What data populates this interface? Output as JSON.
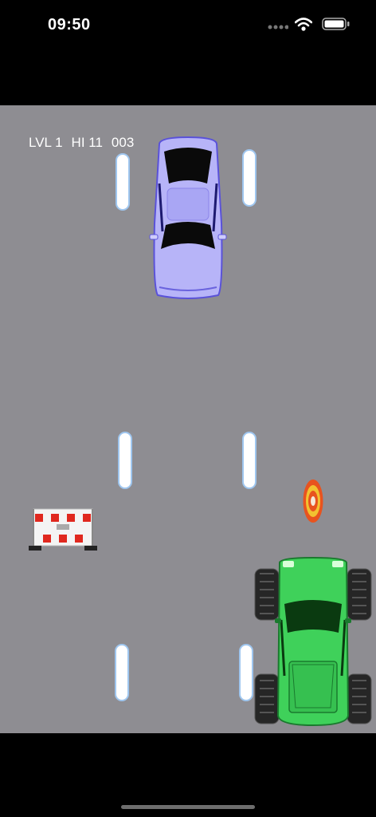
{
  "status_bar": {
    "time": "09:50",
    "icons": [
      "cellular-dots-icon",
      "wifi-icon",
      "battery-icon"
    ]
  },
  "hud": {
    "level": "LVL 1",
    "high_score": "HI 11",
    "score": "003"
  },
  "colors": {
    "road": "#8e8d92",
    "lane_marking": "#ffffff",
    "player_car": "#3fd15a",
    "opponent_car": "#b7b4f8",
    "barrier_red": "#e0281f"
  },
  "sprites": {
    "opponent": "purple-sedan",
    "player": "green-monster-truck",
    "obstacle": "roadwork-barrier",
    "pickup": "target-coin"
  }
}
